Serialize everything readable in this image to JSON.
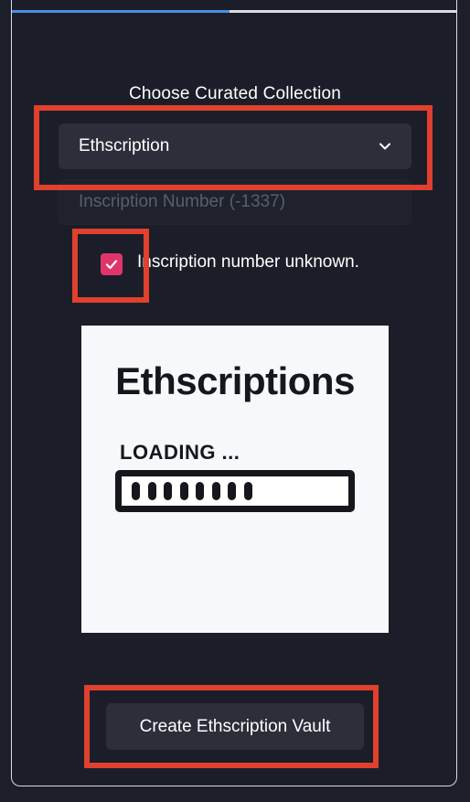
{
  "progress": {
    "value_fraction": 0.49,
    "fill_color": "#4a90e2"
  },
  "form": {
    "heading": "Choose Curated Collection",
    "collection_select": {
      "selected": "Ethscription"
    },
    "inscription_input": {
      "value": "",
      "placeholder": "Inscription Number (-1337)"
    },
    "unknown_checkbox": {
      "checked": true,
      "label": "Inscription number unknown."
    }
  },
  "preview": {
    "title": "Ethscriptions",
    "loading_text": "LOADING ...",
    "loading_segments": 8
  },
  "actions": {
    "create_label": "Create Ethscription Vault"
  },
  "colors": {
    "background": "#1c1f2a",
    "control": "#2c2f3a",
    "checkbox": "#e0356a",
    "highlight": "#e0402e"
  }
}
